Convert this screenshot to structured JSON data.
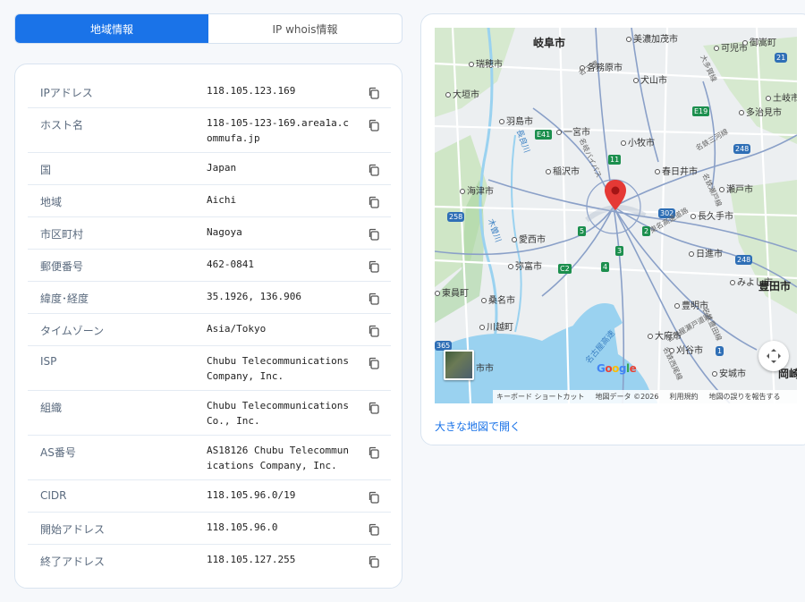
{
  "tabs": [
    {
      "label": "地域情報",
      "active": true
    },
    {
      "label": "IP whois情報",
      "active": false
    }
  ],
  "info_rows": [
    {
      "label": "IPアドレス",
      "value": "118.105.123.169"
    },
    {
      "label": "ホスト名",
      "value": "118-105-123-169.area1a.commufa.jp"
    },
    {
      "label": "国",
      "value": "Japan"
    },
    {
      "label": "地域",
      "value": "Aichi"
    },
    {
      "label": "市区町村",
      "value": "Nagoya"
    },
    {
      "label": "郵便番号",
      "value": "462-0841"
    },
    {
      "label": "緯度･経度",
      "value": "35.1926, 136.906"
    },
    {
      "label": "タイムゾーン",
      "value": "Asia/Tokyo"
    },
    {
      "label": "ISP",
      "value": "Chubu Telecommunications Company, Inc."
    },
    {
      "label": "組織",
      "value": "Chubu Telecommunications Co., Inc."
    },
    {
      "label": "AS番号",
      "value": "AS18126 Chubu Telecommunications Company, Inc."
    },
    {
      "label": "CIDR",
      "value": "118.105.96.0/19"
    },
    {
      "label": "開始アドレス",
      "value": "118.105.96.0"
    },
    {
      "label": "終了アドレス",
      "value": "118.105.127.255"
    }
  ],
  "map": {
    "cities": [
      {
        "name": "岐阜市",
        "big": true
      },
      {
        "name": "美濃加茂市",
        "big": false
      },
      {
        "name": "可児市",
        "big": false
      },
      {
        "name": "御嵩町",
        "big": false
      },
      {
        "name": "瑞穂市",
        "big": false
      },
      {
        "name": "各務原市",
        "big": false
      },
      {
        "name": "犬山市",
        "big": false
      },
      {
        "name": "大垣市",
        "big": false
      },
      {
        "name": "土岐市",
        "big": false
      },
      {
        "name": "羽島市",
        "big": false
      },
      {
        "name": "多治見市",
        "big": false
      },
      {
        "name": "一宮市",
        "big": false
      },
      {
        "name": "小牧市",
        "big": false
      },
      {
        "name": "稲沢市",
        "big": false
      },
      {
        "name": "春日井市",
        "big": false
      },
      {
        "name": "海津市",
        "big": false
      },
      {
        "name": "瀬戸市",
        "big": false
      },
      {
        "name": "長久手市",
        "big": false
      },
      {
        "name": "愛西市",
        "big": false
      },
      {
        "name": "日進市",
        "big": false
      },
      {
        "name": "弥富市",
        "big": false
      },
      {
        "name": "みよし市",
        "big": false
      },
      {
        "name": "豊田市",
        "big": true
      },
      {
        "name": "東員町",
        "big": false
      },
      {
        "name": "桑名市",
        "big": false
      },
      {
        "name": "豊明市",
        "big": false
      },
      {
        "name": "川越町",
        "big": false
      },
      {
        "name": "大府市",
        "big": false
      },
      {
        "name": "刈谷市",
        "big": false
      },
      {
        "name": "安城市",
        "big": false
      },
      {
        "name": "岡崎",
        "big": true
      },
      {
        "name": "市市",
        "big": false
      }
    ],
    "road_shields": [
      {
        "label": "21",
        "kind": "blue"
      },
      {
        "label": "E19",
        "kind": "green"
      },
      {
        "label": "E41",
        "kind": "green"
      },
      {
        "label": "11",
        "kind": "green"
      },
      {
        "label": "248",
        "kind": "blue"
      },
      {
        "label": "258",
        "kind": "blue"
      },
      {
        "label": "302",
        "kind": "blue"
      },
      {
        "label": "5",
        "kind": "green"
      },
      {
        "label": "2",
        "kind": "green"
      },
      {
        "label": "3",
        "kind": "green"
      },
      {
        "label": "C2",
        "kind": "green"
      },
      {
        "label": "4",
        "kind": "green"
      },
      {
        "label": "248",
        "kind": "blue"
      },
      {
        "label": "1",
        "kind": "blue"
      },
      {
        "label": "365",
        "kind": "blue"
      }
    ],
    "river_labels": [
      "木曽川",
      "長良川",
      "名古屋高速"
    ],
    "road_labels": [
      "名岐バイパス",
      "東名高速道路",
      "名鉄瀬戸線",
      "名古屋瀬戸道路",
      "名鉄豊田線",
      "名二環",
      "名鉄西尾線",
      "名鉄三河線",
      "大多賀線"
    ],
    "google_logo": "Google",
    "attribution": {
      "shortcuts": "キーボード ショートカット",
      "data": "地図データ ©2026",
      "terms": "利用規約",
      "report": "地図の誤りを報告する"
    }
  },
  "map_link": "大きな地図で開く",
  "colors": {
    "accent": "#1a73e8",
    "water": "#9ad2f0",
    "land": "#e8ecef",
    "green": "#cfe6c6",
    "pin": "#e53935"
  }
}
